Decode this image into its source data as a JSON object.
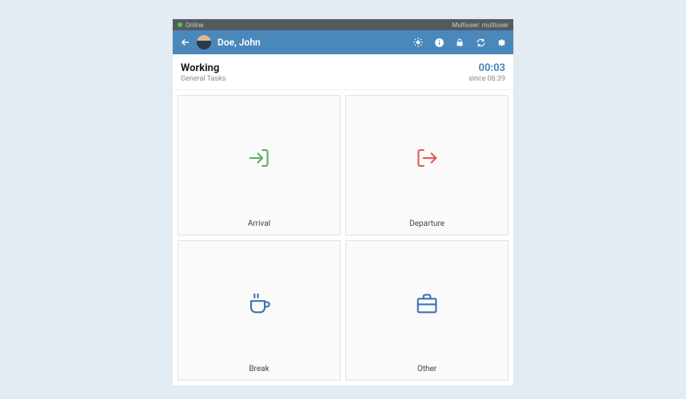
{
  "topbar": {
    "status": "Online",
    "right": "Multiuser: multiuser"
  },
  "header": {
    "user_name": "Doe, John"
  },
  "status": {
    "title": "Working",
    "subtitle": "General Tasks",
    "timer": "00:03",
    "since": "since 06:39"
  },
  "tiles": {
    "arrival_label": "Arrival",
    "departure_label": "Departure",
    "break_label": "Break",
    "other_label": "Other"
  },
  "colors": {
    "arrival": "#60b060",
    "departure": "#e15a5a",
    "break": "#3f72b0",
    "other": "#3f72b0"
  }
}
